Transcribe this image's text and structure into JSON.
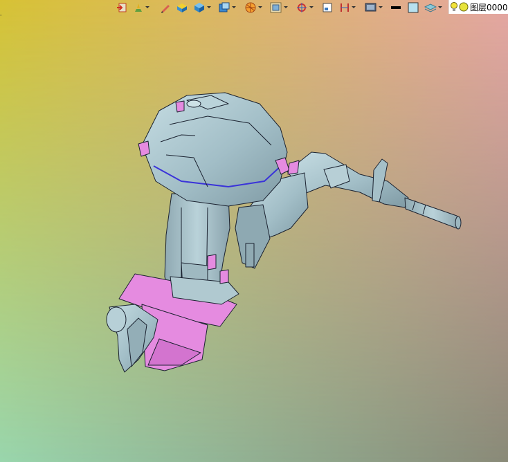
{
  "canvas": {
    "gradient_colors": {
      "top_left": "#d7c234",
      "top_right": "#e6a7a2",
      "bottom_left": "#99d6ad",
      "bottom_right": "#8a8a78"
    }
  },
  "corner_mark": "⸳",
  "toolbar": {
    "buttons": [
      {
        "icon": "import-icon",
        "dropdown": false
      },
      {
        "icon": "paint-layer-icon",
        "dropdown": true
      },
      {
        "icon": "pencil-icon",
        "dropdown": false
      },
      {
        "icon": "yellow-block-icon",
        "dropdown": false
      },
      {
        "icon": "blue-cube-icon",
        "dropdown": true
      },
      {
        "icon": "view-cube-icon",
        "dropdown": true
      },
      {
        "icon": "render-sphere-icon",
        "dropdown": true
      },
      {
        "icon": "frame-icon",
        "dropdown": true
      },
      {
        "icon": "pivot-icon",
        "dropdown": true
      },
      {
        "icon": "sheet-icon",
        "dropdown": false
      },
      {
        "icon": "dimension-icon",
        "dropdown": true
      },
      {
        "icon": "display-icon",
        "dropdown": true
      },
      {
        "icon": "line-color-icon",
        "dropdown": false
      },
      {
        "icon": "fill-color-icon",
        "dropdown": false
      },
      {
        "icon": "layer-stack-icon",
        "dropdown": true
      }
    ],
    "layer": {
      "name": "图层0000",
      "bulb_color": "#f2e33a",
      "sun_color": "#e7e33a"
    },
    "line_color": "#000000",
    "fill_color": "#b8e0ef"
  },
  "model": {
    "body_color": "#a9c6cf",
    "accent_color": "#e58be0",
    "edge_color": "#1b2230",
    "highlight_color": "#3a33d9"
  }
}
